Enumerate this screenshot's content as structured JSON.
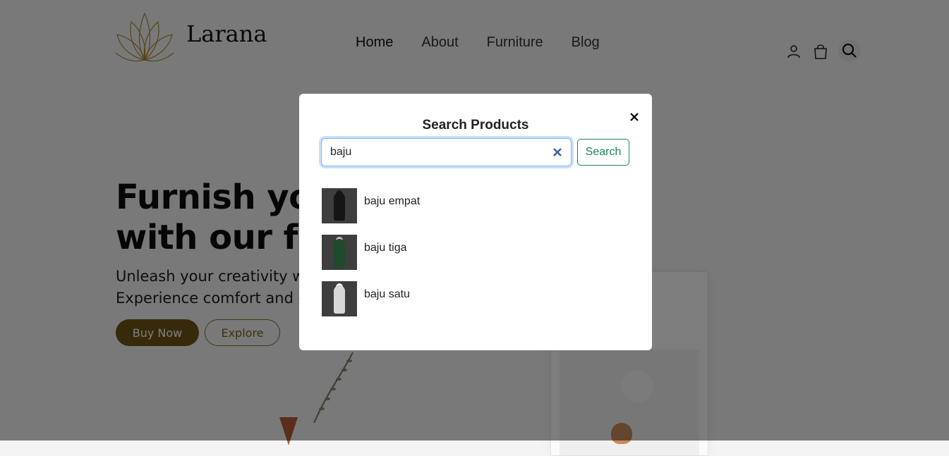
{
  "header": {
    "brand": "Larana",
    "nav": [
      "Home",
      "About",
      "Furniture",
      "Blog"
    ]
  },
  "hero": {
    "title_line1": "Furnish you",
    "title_line2": "with our fur",
    "sub_line1": "Unleash your creativity w",
    "sub_line2": "Experience comfort and c",
    "buy_label": "Buy Now",
    "explore_label": "Explore"
  },
  "modal": {
    "title": "Search Products",
    "query": "baju",
    "search_label": "Search",
    "results": [
      {
        "label": "baju empat",
        "dress_color": "#151515",
        "head_color": "#1a1a1a"
      },
      {
        "label": "baju tiga",
        "dress_color": "#1f4a2c",
        "head_color": "#bfbfbf"
      },
      {
        "label": "baju satu",
        "dress_color": "#d8d8d8",
        "head_color": "#f0f0f0"
      }
    ]
  },
  "colors": {
    "brand_gold": "#6f5416",
    "search_green": "#198754",
    "focus_blue": "#86b7fe"
  }
}
